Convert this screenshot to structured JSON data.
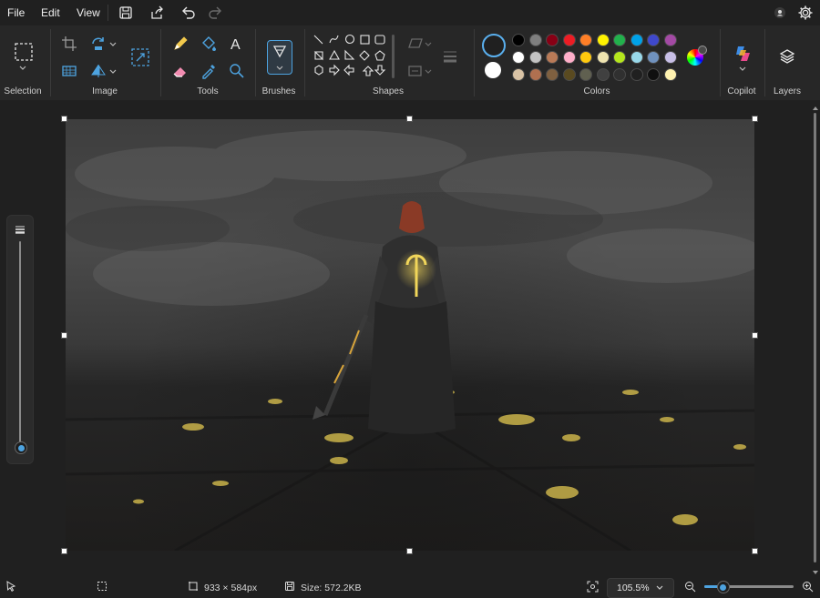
{
  "menu": {
    "file": "File",
    "edit": "Edit",
    "view": "View"
  },
  "ribbon": {
    "groups": {
      "selection": "Selection",
      "image": "Image",
      "tools": "Tools",
      "brushes": "Brushes",
      "shapes": "Shapes",
      "colors": "Colors",
      "copilot": "Copilot",
      "layers": "Layers"
    },
    "tools": {
      "text_icon": "A"
    }
  },
  "palette": {
    "primary": "#202020",
    "secondary": "#ffffff",
    "row1": [
      "#000000",
      "#7f7f7f",
      "#880015",
      "#ed1c24",
      "#ff7f27",
      "#fff200",
      "#22b14c",
      "#00a2e8",
      "#3f48cc",
      "#a349a4"
    ],
    "row2": [
      "#ffffff",
      "#c3c3c3",
      "#b97a57",
      "#ffaec9",
      "#ffc90e",
      "#efe4b0",
      "#b5e61d",
      "#99d9ea",
      "#7092be",
      "#c8bfe7"
    ],
    "row3": [
      "#d9c3a5",
      "#b07050",
      "#7f6040",
      "#5a4a20",
      "#606050",
      "#404040",
      "#303030",
      "#202020",
      "#101010",
      "#fff2b0"
    ]
  },
  "status": {
    "dimensions": "933 × 584px",
    "size": "Size: 572.2KB",
    "zoom": "105.5%"
  },
  "zoom_slider_level": 0.2
}
